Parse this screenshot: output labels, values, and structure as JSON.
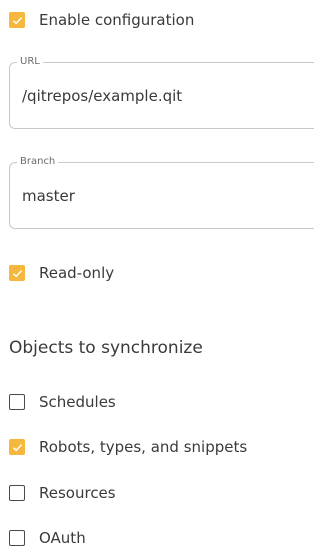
{
  "enable_configuration": {
    "label": "Enable configuration",
    "checked": true
  },
  "url_field": {
    "legend": "URL",
    "value": "/qitrepos/example.qit"
  },
  "branch_field": {
    "legend": "Branch",
    "value": "master"
  },
  "read_only": {
    "label": "Read-only",
    "checked": true
  },
  "objects_section": {
    "title": "Objects to synchronize",
    "items": [
      {
        "label": "Schedules",
        "checked": false
      },
      {
        "label": "Robots, types, and snippets",
        "checked": true
      },
      {
        "label": "Resources",
        "checked": false
      },
      {
        "label": "OAuth",
        "checked": false
      }
    ]
  },
  "colors": {
    "accent": "#f5b73d",
    "border": "#c9c9c9",
    "text": "#3a3a3a"
  }
}
